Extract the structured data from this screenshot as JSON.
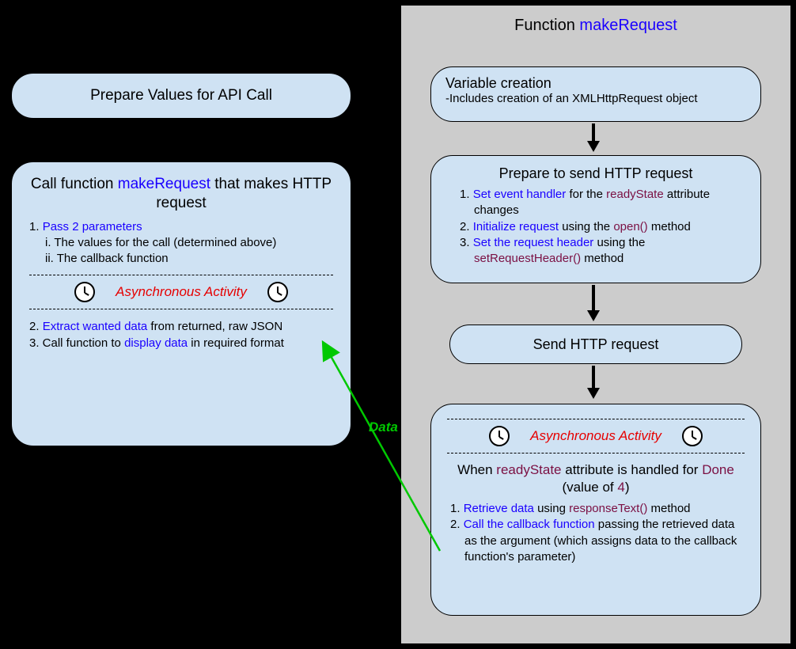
{
  "leftBox1": {
    "title": "Prepare Values for API Call"
  },
  "leftBox2": {
    "titlePrefix": "Call function ",
    "titleFn": "makeRequest",
    "titleSuffix": " that makes HTTP request",
    "item1_num": "1. ",
    "item1_blue": "Pass 2 parameters",
    "item1_i": "i. The values for the call (determined above)",
    "item1_ii": "ii. The callback function",
    "asyncLabel": "Asynchronous Activity",
    "item2_num": "2. ",
    "item2_blue": "Extract wanted data",
    "item2_rest": " from returned, raw JSON",
    "item3_num": "3. Call function to ",
    "item3_blue": "display data",
    "item3_rest": " in required format"
  },
  "rightPanel": {
    "titlePrefix": "Function ",
    "titleFn": "makeRequest"
  },
  "rBox1": {
    "title": "Variable creation",
    "sub": "-Includes creation of an XMLHttpRequest object"
  },
  "rBox2": {
    "title": "Prepare to send HTTP request",
    "i1_num": "1. ",
    "i1_blue": "Set event handler",
    "i1_mid": " for the ",
    "i1_mag": "readyState",
    "i1_end": " attribute changes",
    "i2_num": "2. ",
    "i2_blue": "Initialize request",
    "i2_mid": " using the ",
    "i2_mag": "open()",
    "i2_end": " method",
    "i3_num": "3. ",
    "i3_blue": "Set the request header",
    "i3_mid": " using the ",
    "i3_mag": "setRequestHeader()",
    "i3_end": " method"
  },
  "rBox3": {
    "title": "Send HTTP request"
  },
  "rBox4": {
    "asyncLabel": "Asynchronous Activity",
    "line1_a": "When ",
    "line1_mag1": "readyState",
    "line1_b": " attribute is handled for ",
    "line1_mag2": "Done",
    "line1_c": " (value of ",
    "line1_mag3": "4",
    "line1_d": ")",
    "i1_num": "1. ",
    "i1_blue": "Retrieve data",
    "i1_mid": " using ",
    "i1_mag": "responseText()",
    "i1_end": " method",
    "i2_num": "2. ",
    "i2_blue": "Call the callback function",
    "i2_rest": " passing the retrieved data as the argument (which assigns data to the callback function's parameter)"
  },
  "dataLabel": "Data"
}
